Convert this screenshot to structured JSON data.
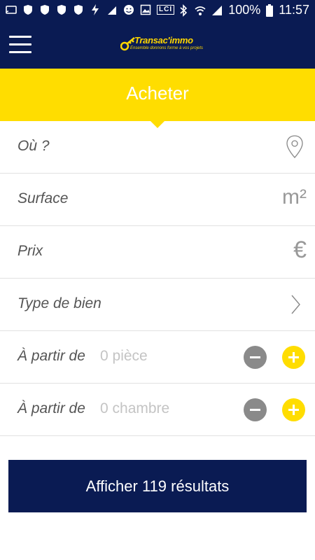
{
  "status_bar": {
    "network_badge": "LCI",
    "battery": "100%",
    "time": "11:57"
  },
  "header": {
    "logo_text": "Transac'immo",
    "logo_tagline": "Ensemble donnons forme à vos projets"
  },
  "tab": {
    "title": "Acheter"
  },
  "form": {
    "location_label": "Où ?",
    "surface_label": "Surface",
    "surface_unit": "m²",
    "price_label": "Prix",
    "price_unit": "€",
    "property_type_label": "Type de bien",
    "rooms": {
      "label": "À partir de",
      "value": "0 pièce"
    },
    "bedrooms": {
      "label": "À partir de",
      "value": "0 chambre"
    }
  },
  "results_button": {
    "label": "Afficher 119 résultats"
  },
  "colors": {
    "navy": "#0a1b53",
    "yellow": "#ffdd00",
    "gray": "#8a8a8a"
  },
  "icons": [
    "location-pin-icon",
    "square-meter-icon",
    "euro-icon",
    "chevron-right-icon",
    "minus-icon",
    "plus-icon",
    "menu-icon"
  ]
}
